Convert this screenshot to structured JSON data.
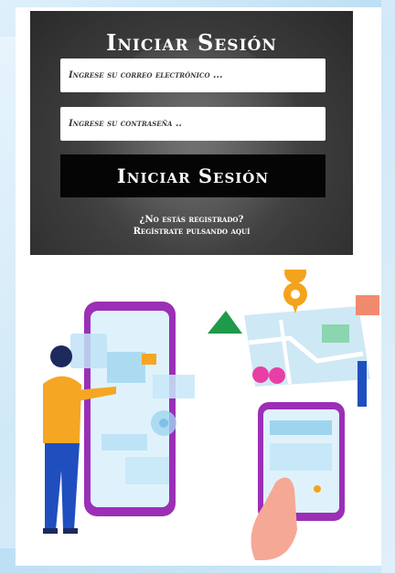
{
  "login": {
    "title": "Iniciar Sesión",
    "email_placeholder": "Ingrese su correo electrónico ...",
    "password_placeholder": "Ingrese su contraseña ..",
    "submit_label": "Iniciar Sesión",
    "register_question": "¿No estás registrado?",
    "register_link": "Regístrate pulsando aquí"
  },
  "colors": {
    "panel": "#3c3c3c",
    "button": "#050505",
    "phone_frame": "#9b2fb6",
    "map_pin": "#f4a31d",
    "shirt": "#f5a623",
    "pants": "#1f4fbf"
  },
  "illustration": {
    "left": "person-touching-phone-screen",
    "right": "hand-holding-phone-with-map"
  }
}
